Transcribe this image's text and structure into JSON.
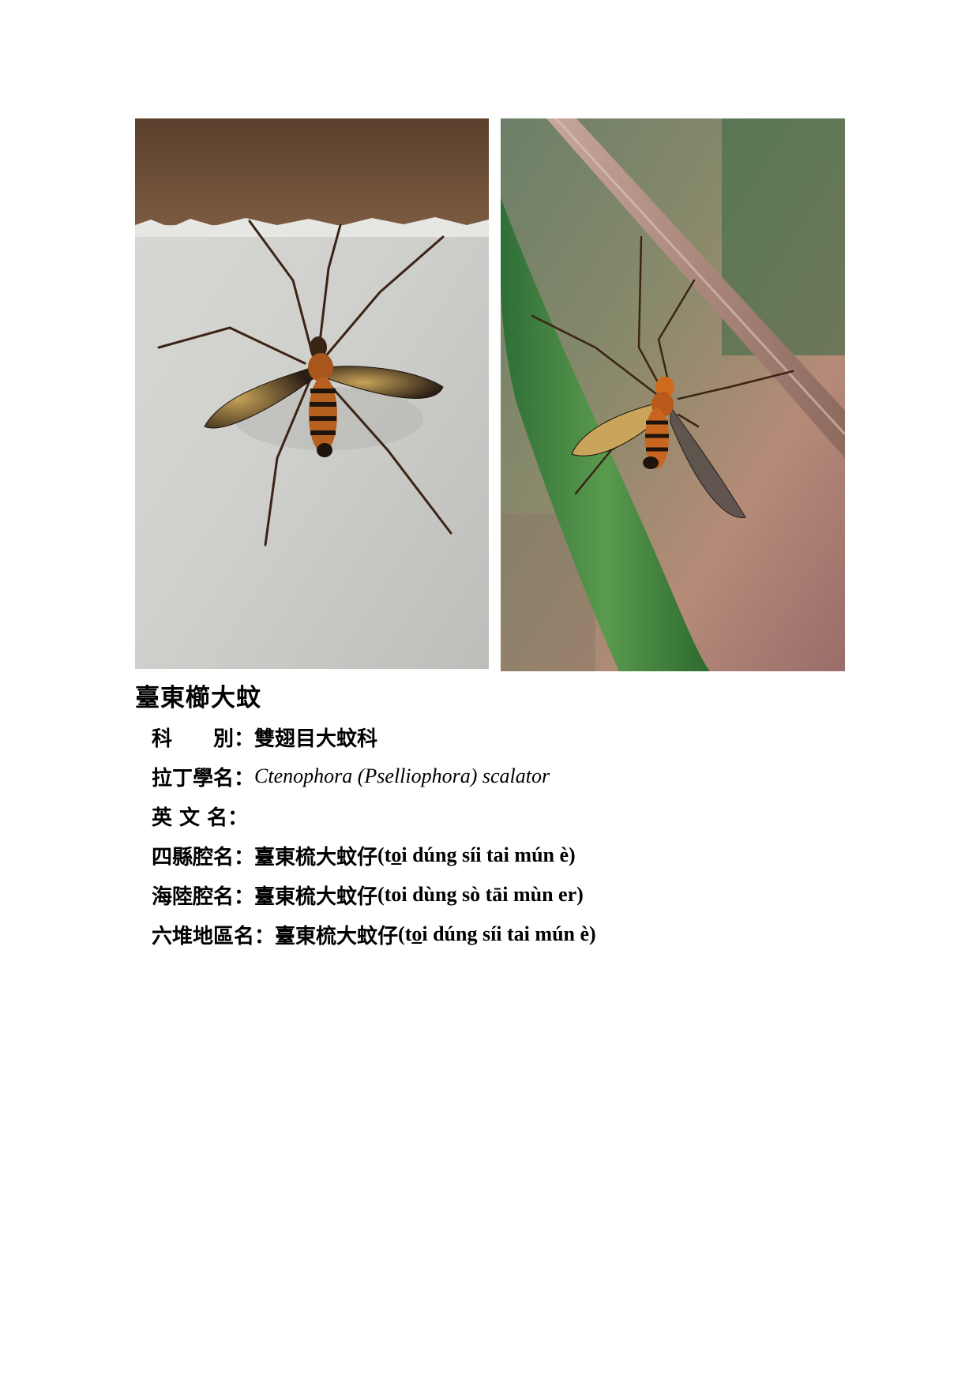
{
  "photos": {
    "left": {
      "subject": "crane fly on concrete wall"
    },
    "right": {
      "subject": "crane fly hanging from twig"
    }
  },
  "title": "臺東櫛大蚊",
  "fields": {
    "family": {
      "label": "科　　別：",
      "value": "雙翅目大蚊科"
    },
    "latin": {
      "label": "拉丁學名：",
      "value": "Ctenophora (Pselliophora) scalator"
    },
    "english": {
      "label": "英 文 名：",
      "value": ""
    },
    "sixian": {
      "label": "四縣腔名：",
      "value_cn": "臺東梳大蚊仔",
      "rom_pre": "(t",
      "rom_u": "o",
      "rom_post": "i dúng síi tai mún è)"
    },
    "hailu": {
      "label": "海陸腔名：",
      "value_cn": "臺東梳大蚊仔",
      "rom": "(toi dùng sò tāi mùn er)"
    },
    "liudui": {
      "label": "六堆地區名：",
      "value_cn": "臺東梳大蚊仔",
      "rom_pre": "(t",
      "rom_u": "o",
      "rom_post": "i dúng síi tai mún è)"
    }
  }
}
